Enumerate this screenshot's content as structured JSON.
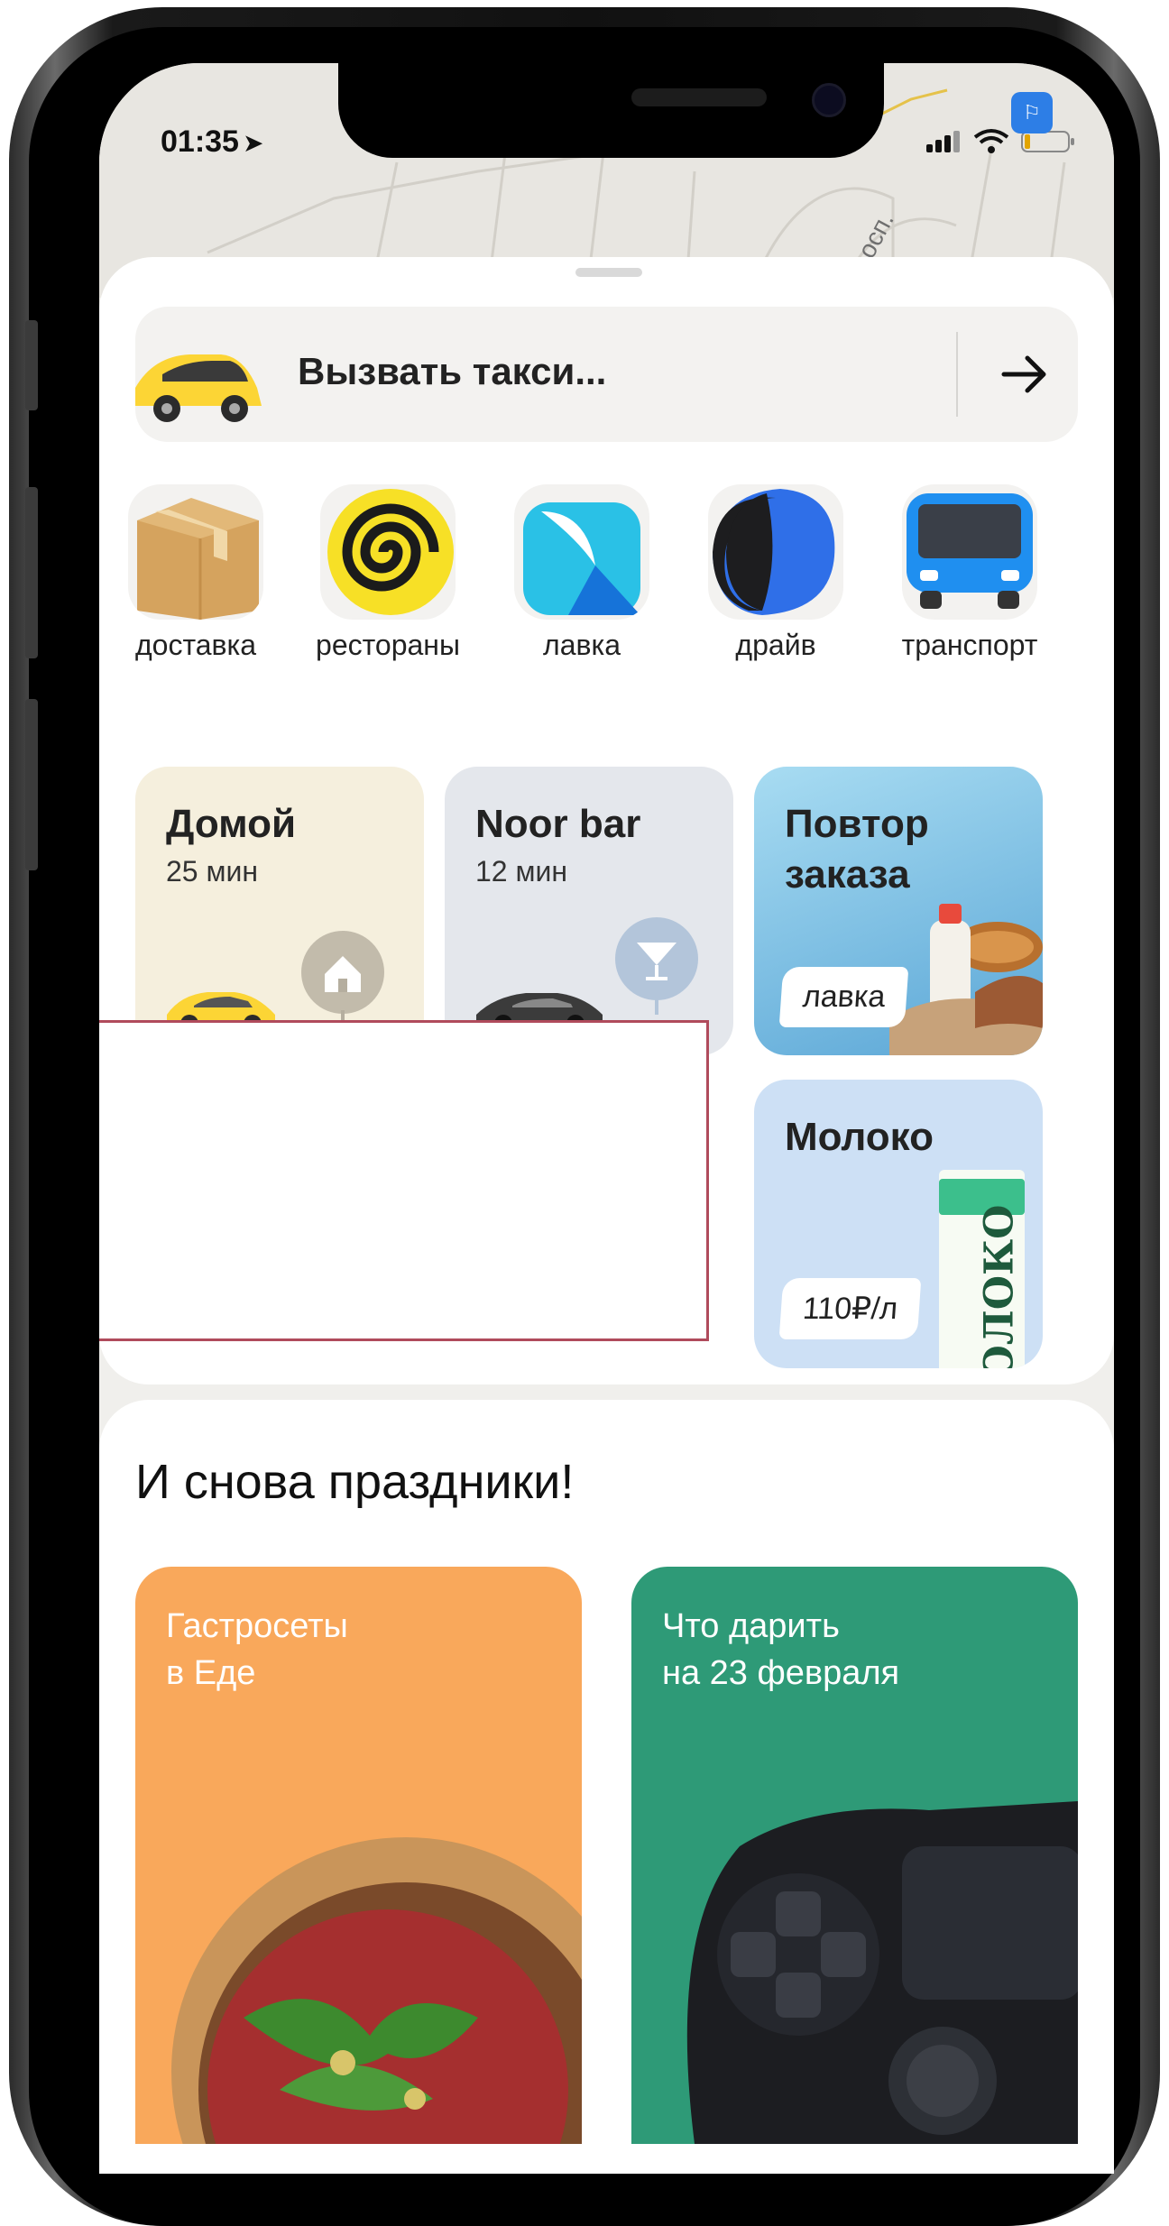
{
  "status_bar": {
    "time": "01:35"
  },
  "map": {
    "street_label": "осп."
  },
  "taxi": {
    "label": "Вызвать такси..."
  },
  "services": [
    {
      "label": "доставка",
      "icon": "box-icon"
    },
    {
      "label": "рестораны",
      "icon": "spiral-icon"
    },
    {
      "label": "лавка",
      "icon": "lavka-icon"
    },
    {
      "label": "драйв",
      "icon": "drive-icon"
    },
    {
      "label": "транспорт",
      "icon": "bus-icon"
    }
  ],
  "shortcuts": {
    "home": {
      "title": "Домой",
      "eta": "25 мин"
    },
    "noor": {
      "title": "Noor bar",
      "eta": "12 мин"
    },
    "repeat": {
      "title": "Повтор\nзаказа",
      "tag": "лавка"
    },
    "milk": {
      "title": "Молоко",
      "price": "110₽/л",
      "product_text": "ОЛОКО"
    }
  },
  "holiday": {
    "title": "И снова праздники!",
    "cards": [
      {
        "text": "Гастросеты\nв Еде",
        "color": "#f9a85b"
      },
      {
        "text": "Что дарить\nна 23 февраля",
        "color": "#2e9a77"
      }
    ]
  },
  "colors": {
    "accent_yellow": "#fcd535",
    "ad_border": "#b04b5c"
  }
}
